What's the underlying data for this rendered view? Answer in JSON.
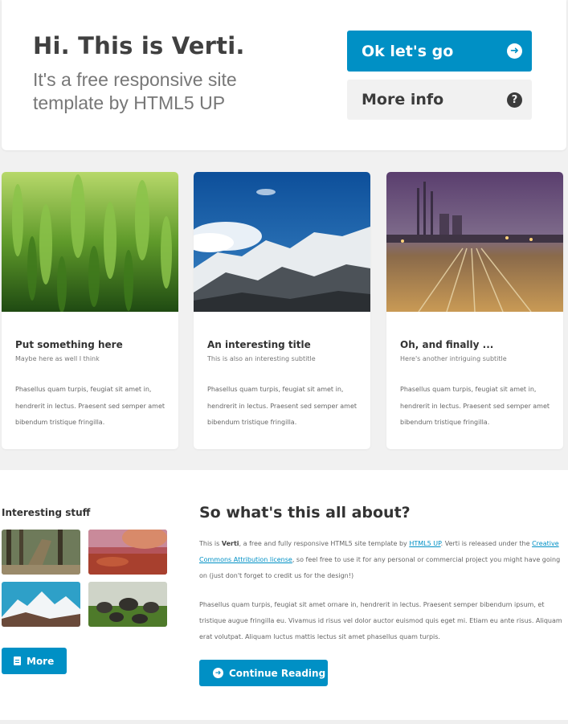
{
  "banner": {
    "title": "Hi. This is Verti.",
    "subtitle": "It's a free responsive site template by HTML5 UP",
    "buttons": [
      {
        "label": "Ok let's go",
        "icon": "arrow-circle-right-icon"
      },
      {
        "label": "More info",
        "icon": "question-circle-icon"
      }
    ]
  },
  "features": [
    {
      "title": "Put something here",
      "subtitle": "Maybe here as well I think",
      "text": "Phasellus quam turpis, feugiat sit amet in, hendrerit in lectus. Praesent sed semper amet bibendum tristique fringilla.",
      "image": "wheat-field"
    },
    {
      "title": "An interesting title",
      "subtitle": "This is also an interesting subtitle",
      "text": "Phasellus quam turpis, feugiat sit amet in, hendrerit in lectus. Praesent sed semper amet bibendum tristique fringilla.",
      "image": "snowy-mountains"
    },
    {
      "title": "Oh, and finally ...",
      "subtitle": "Here's another intriguing subtitle",
      "text": "Phasellus quam turpis, feugiat sit amet in, hendrerit in lectus. Praesent sed semper amet bibendum tristique fringilla.",
      "image": "railway-city"
    }
  ],
  "sidebar": {
    "title": "Interesting stuff",
    "thumbnails": [
      "forest-ruins",
      "autumn-leaves",
      "mountain-peaks",
      "boulders-grass"
    ],
    "more_label": "More"
  },
  "content": {
    "title": "So what's this all about?",
    "p1_a": "This is ",
    "p1_strong": "Verti",
    "p1_b": ", a free and fully responsive HTML5 site template by ",
    "p1_link1": "HTML5 UP",
    "p1_c": ". Verti is released under the ",
    "p1_link2": "Creative Commons Attribution license",
    "p1_d": ", so feel free to use it for any personal or commercial project you might have going on (just don't forget to credit us for the design!)",
    "p2": "Phasellus quam turpis, feugiat sit amet ornare in, hendrerit in lectus. Praesent semper bibendum ipsum, et tristique augue fringilla eu. Vivamus id risus vel dolor auctor euismod quis eget mi. Etiam eu ante risus. Aliquam erat volutpat. Aliquam luctus mattis lectus sit amet phasellus quam turpis.",
    "continue_label": "Continue Reading"
  },
  "colors": {
    "accent": "#0090c5",
    "background": "#f1f1f1",
    "text": "#474747"
  }
}
